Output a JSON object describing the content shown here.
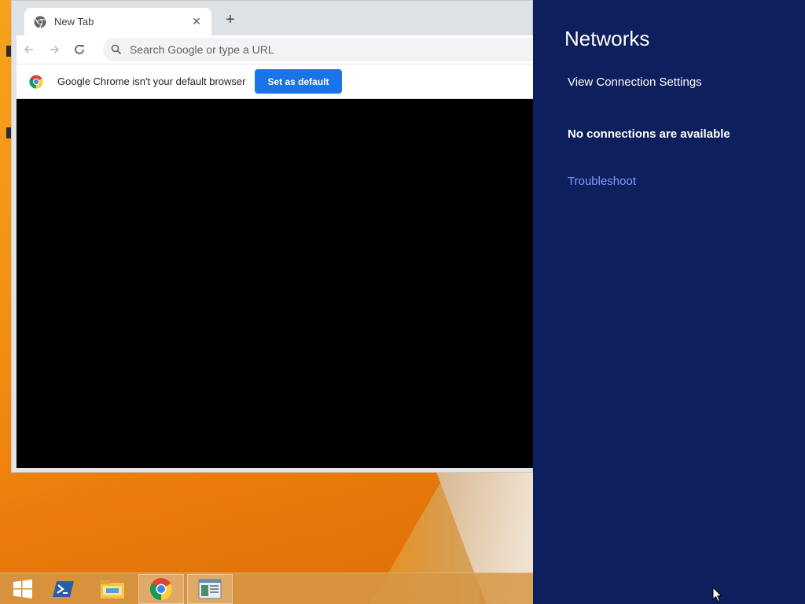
{
  "browser": {
    "tab": {
      "title": "New Tab",
      "close_glyph": "✕"
    },
    "new_tab_glyph": "+",
    "toolbar": {
      "back_icon": "back-arrow-icon",
      "forward_icon": "forward-arrow-icon",
      "reload_icon": "reload-icon",
      "omnibox_placeholder": "Search Google or type a URL"
    },
    "infobar": {
      "message": "Google Chrome isn't your default browser",
      "button_label": "Set as default"
    }
  },
  "networks_panel": {
    "heading": "Networks",
    "view_settings": "View Connection Settings",
    "status": "No connections are available",
    "troubleshoot": "Troubleshoot",
    "colors": {
      "background": "#0e1f5e",
      "link": "#7f9cff"
    }
  },
  "taskbar": {
    "items": [
      {
        "icon": "windows-start-icon",
        "active": false
      },
      {
        "icon": "powershell-icon",
        "active": false
      },
      {
        "icon": "file-explorer-icon",
        "active": false
      },
      {
        "icon": "chrome-icon",
        "active": true
      },
      {
        "icon": "app-window-icon",
        "active": true
      }
    ]
  }
}
